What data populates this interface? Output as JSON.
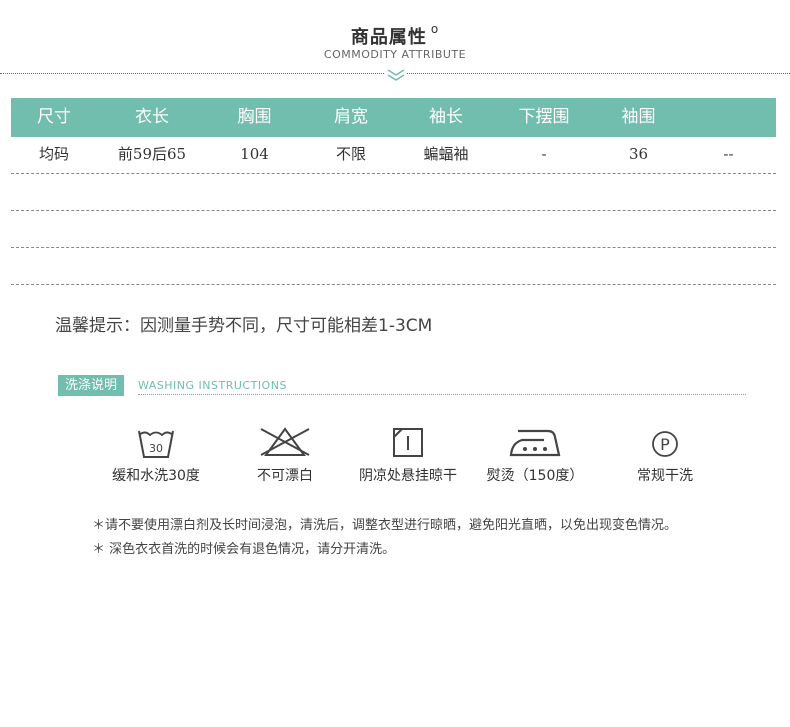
{
  "header": {
    "title": "商品属性",
    "title_mark": "o",
    "subtitle": "COMMODITY ATTRIBUTE"
  },
  "size_table": {
    "columns": [
      "尺寸",
      "衣长",
      "胸围",
      "肩宽",
      "袖长",
      "下摆围",
      "袖围",
      ""
    ],
    "rows": [
      [
        "均码",
        "前59后65",
        "104",
        "不限",
        "蝙蝠袖",
        "-",
        "36",
        "--"
      ],
      [
        "",
        "",
        "",
        "",
        "",
        "",
        "",
        ""
      ],
      [
        "",
        "",
        "",
        "",
        "",
        "",
        "",
        ""
      ],
      [
        "",
        "",
        "",
        "",
        "",
        "",
        "",
        ""
      ]
    ]
  },
  "tip": "温馨提示：因测量手势不同，尺寸可能相差1-3CM",
  "washing": {
    "badge": "洗涤说明",
    "title_en": "WASHING INSTRUCTIONS",
    "icons": [
      {
        "icon": "wash-30-icon",
        "label": "缓和水洗30度",
        "temp": "30"
      },
      {
        "icon": "no-bleach-icon",
        "label": "不可漂白"
      },
      {
        "icon": "hang-dry-shade-icon",
        "label": "阴凉处悬挂晾干"
      },
      {
        "icon": "iron-icon",
        "label": "熨烫（150度）"
      },
      {
        "icon": "dry-clean-icon",
        "label": "常规干洗",
        "symbol": "P"
      }
    ],
    "notes": [
      "＊请不要使用漂白剂及长时间浸泡，清洗后，调整衣型进行晾晒，避免阳光直晒，以免出现变色情况。",
      "＊ 深色衣衣首洗的时候会有退色情况，请分开清洗。"
    ]
  },
  "colors": {
    "accent": "#71bdae"
  }
}
